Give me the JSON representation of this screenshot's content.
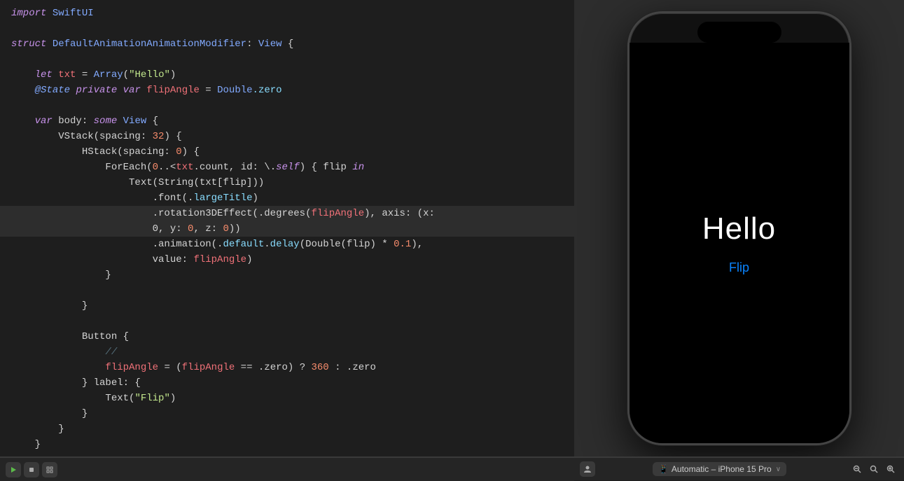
{
  "editor": {
    "lines": [
      {
        "id": 1,
        "tokens": [
          {
            "text": "import",
            "cls": "kw-import"
          },
          {
            "text": " ",
            "cls": "plain"
          },
          {
            "text": "SwiftUI",
            "cls": "type-name"
          }
        ],
        "highlight": false
      },
      {
        "id": 2,
        "tokens": [],
        "highlight": false
      },
      {
        "id": 3,
        "tokens": [
          {
            "text": "struct",
            "cls": "kw-struct"
          },
          {
            "text": " ",
            "cls": "plain"
          },
          {
            "text": "DefaultAnimationAnimationModifier",
            "cls": "type-name"
          },
          {
            "text": ": ",
            "cls": "plain"
          },
          {
            "text": "View",
            "cls": "type-view"
          },
          {
            "text": " {",
            "cls": "plain"
          }
        ],
        "highlight": false
      },
      {
        "id": 4,
        "tokens": [],
        "highlight": false
      },
      {
        "id": 5,
        "tokens": [
          {
            "text": "    let",
            "cls": "kw-let"
          },
          {
            "text": " ",
            "cls": "plain"
          },
          {
            "text": "txt",
            "cls": "var-name"
          },
          {
            "text": " = ",
            "cls": "plain"
          },
          {
            "text": "Array",
            "cls": "type-name"
          },
          {
            "text": "(",
            "cls": "plain"
          },
          {
            "text": "\"Hello\"",
            "cls": "string"
          },
          {
            "text": ")",
            "cls": "plain"
          }
        ],
        "highlight": false
      },
      {
        "id": 6,
        "tokens": [
          {
            "text": "    ",
            "cls": "plain"
          },
          {
            "text": "@State",
            "cls": "kw-state"
          },
          {
            "text": " ",
            "cls": "plain"
          },
          {
            "text": "private",
            "cls": "kw-private"
          },
          {
            "text": " ",
            "cls": "plain"
          },
          {
            "text": "var",
            "cls": "kw-var"
          },
          {
            "text": " ",
            "cls": "plain"
          },
          {
            "text": "flipAngle",
            "cls": "var-name"
          },
          {
            "text": " = ",
            "cls": "plain"
          },
          {
            "text": "Double",
            "cls": "type-name"
          },
          {
            "text": ".zero",
            "cls": "dot-method"
          }
        ],
        "highlight": false
      },
      {
        "id": 7,
        "tokens": [],
        "highlight": false
      },
      {
        "id": 8,
        "tokens": [
          {
            "text": "    ",
            "cls": "plain"
          },
          {
            "text": "var",
            "cls": "kw-var"
          },
          {
            "text": " body: ",
            "cls": "plain"
          },
          {
            "text": "some",
            "cls": "kw-some"
          },
          {
            "text": " ",
            "cls": "plain"
          },
          {
            "text": "View",
            "cls": "type-view"
          },
          {
            "text": " {",
            "cls": "plain"
          }
        ],
        "highlight": false
      },
      {
        "id": 9,
        "tokens": [
          {
            "text": "        VStack(spacing: ",
            "cls": "plain"
          },
          {
            "text": "32",
            "cls": "number"
          },
          {
            "text": ") {",
            "cls": "plain"
          }
        ],
        "highlight": false
      },
      {
        "id": 10,
        "tokens": [
          {
            "text": "            HStack(spacing: ",
            "cls": "plain"
          },
          {
            "text": "0",
            "cls": "number"
          },
          {
            "text": ") {",
            "cls": "plain"
          }
        ],
        "highlight": false
      },
      {
        "id": 11,
        "tokens": [
          {
            "text": "                ForEach(",
            "cls": "plain"
          },
          {
            "text": "0",
            "cls": "number"
          },
          {
            "text": "..<",
            "cls": "plain"
          },
          {
            "text": "txt",
            "cls": "var-name"
          },
          {
            "text": ".count, id: \\.",
            "cls": "plain"
          },
          {
            "text": "self",
            "cls": "kw-let"
          },
          {
            "text": ") { flip ",
            "cls": "plain"
          },
          {
            "text": "in",
            "cls": "kw-in"
          }
        ],
        "highlight": false
      },
      {
        "id": 12,
        "tokens": [
          {
            "text": "                    Text(String(txt[flip]))",
            "cls": "plain"
          }
        ],
        "highlight": false
      },
      {
        "id": 13,
        "tokens": [
          {
            "text": "                        .font(.",
            "cls": "plain"
          },
          {
            "text": "largeTitle",
            "cls": "dot-method"
          },
          {
            "text": ")",
            "cls": "plain"
          }
        ],
        "highlight": false
      },
      {
        "id": 14,
        "tokens": [
          {
            "text": "                        .rotation3DEffect(",
            "cls": "plain"
          },
          {
            "text": ".degrees(",
            "cls": "plain"
          },
          {
            "text": "flipAngle",
            "cls": "var-name"
          },
          {
            "text": "), axis: (x:",
            "cls": "plain"
          }
        ],
        "highlight": true
      },
      {
        "id": 15,
        "tokens": [
          {
            "text": "                        0, y: ",
            "cls": "plain"
          },
          {
            "text": "0",
            "cls": "number"
          },
          {
            "text": ", z: ",
            "cls": "plain"
          },
          {
            "text": "0",
            "cls": "number"
          },
          {
            "text": "))",
            "cls": "plain"
          }
        ],
        "highlight": true
      },
      {
        "id": 16,
        "tokens": [
          {
            "text": "                        .animation(.",
            "cls": "plain"
          },
          {
            "text": "default",
            "cls": "dot-method"
          },
          {
            "text": ".",
            "cls": "plain"
          },
          {
            "text": "delay",
            "cls": "dot-method"
          },
          {
            "text": "(Double(flip) * ",
            "cls": "plain"
          },
          {
            "text": "0.1",
            "cls": "number"
          },
          {
            "text": "),",
            "cls": "plain"
          }
        ],
        "highlight": false
      },
      {
        "id": 17,
        "tokens": [
          {
            "text": "                        value: ",
            "cls": "plain"
          },
          {
            "text": "flipAngle",
            "cls": "var-name"
          },
          {
            "text": ")",
            "cls": "plain"
          }
        ],
        "highlight": false
      },
      {
        "id": 18,
        "tokens": [
          {
            "text": "                }",
            "cls": "plain"
          }
        ],
        "highlight": false
      },
      {
        "id": 19,
        "tokens": [],
        "highlight": false
      },
      {
        "id": 20,
        "tokens": [
          {
            "text": "            }",
            "cls": "plain"
          }
        ],
        "highlight": false
      },
      {
        "id": 21,
        "tokens": [],
        "highlight": false
      },
      {
        "id": 22,
        "tokens": [
          {
            "text": "            Button {",
            "cls": "plain"
          }
        ],
        "highlight": false
      },
      {
        "id": 23,
        "tokens": [
          {
            "text": "                ",
            "cls": "plain"
          },
          {
            "text": "//",
            "cls": "comment"
          }
        ],
        "highlight": false
      },
      {
        "id": 24,
        "tokens": [
          {
            "text": "                ",
            "cls": "plain"
          },
          {
            "text": "flipAngle",
            "cls": "var-name"
          },
          {
            "text": " = (",
            "cls": "plain"
          },
          {
            "text": "flipAngle",
            "cls": "var-name"
          },
          {
            "text": " == .zero) ? ",
            "cls": "plain"
          },
          {
            "text": "360",
            "cls": "number"
          },
          {
            "text": " : .zero",
            "cls": "plain"
          }
        ],
        "highlight": false
      },
      {
        "id": 25,
        "tokens": [
          {
            "text": "            } label: {",
            "cls": "plain"
          }
        ],
        "highlight": false
      },
      {
        "id": 26,
        "tokens": [
          {
            "text": "                Text(",
            "cls": "plain"
          },
          {
            "text": "\"Flip\"",
            "cls": "string"
          },
          {
            "text": ")",
            "cls": "plain"
          }
        ],
        "highlight": false
      },
      {
        "id": 27,
        "tokens": [
          {
            "text": "            }",
            "cls": "plain"
          }
        ],
        "highlight": false
      },
      {
        "id": 28,
        "tokens": [
          {
            "text": "        }",
            "cls": "plain"
          }
        ],
        "highlight": false
      },
      {
        "id": 29,
        "tokens": [
          {
            "text": "    }",
            "cls": "plain"
          }
        ],
        "highlight": false
      }
    ]
  },
  "preview": {
    "hello_text": "Hello",
    "flip_button": "Flip"
  },
  "bottom_bar": {
    "device_label": "Automatic – iPhone 15 Pro",
    "chevron": "›",
    "device_icon": "📱"
  }
}
